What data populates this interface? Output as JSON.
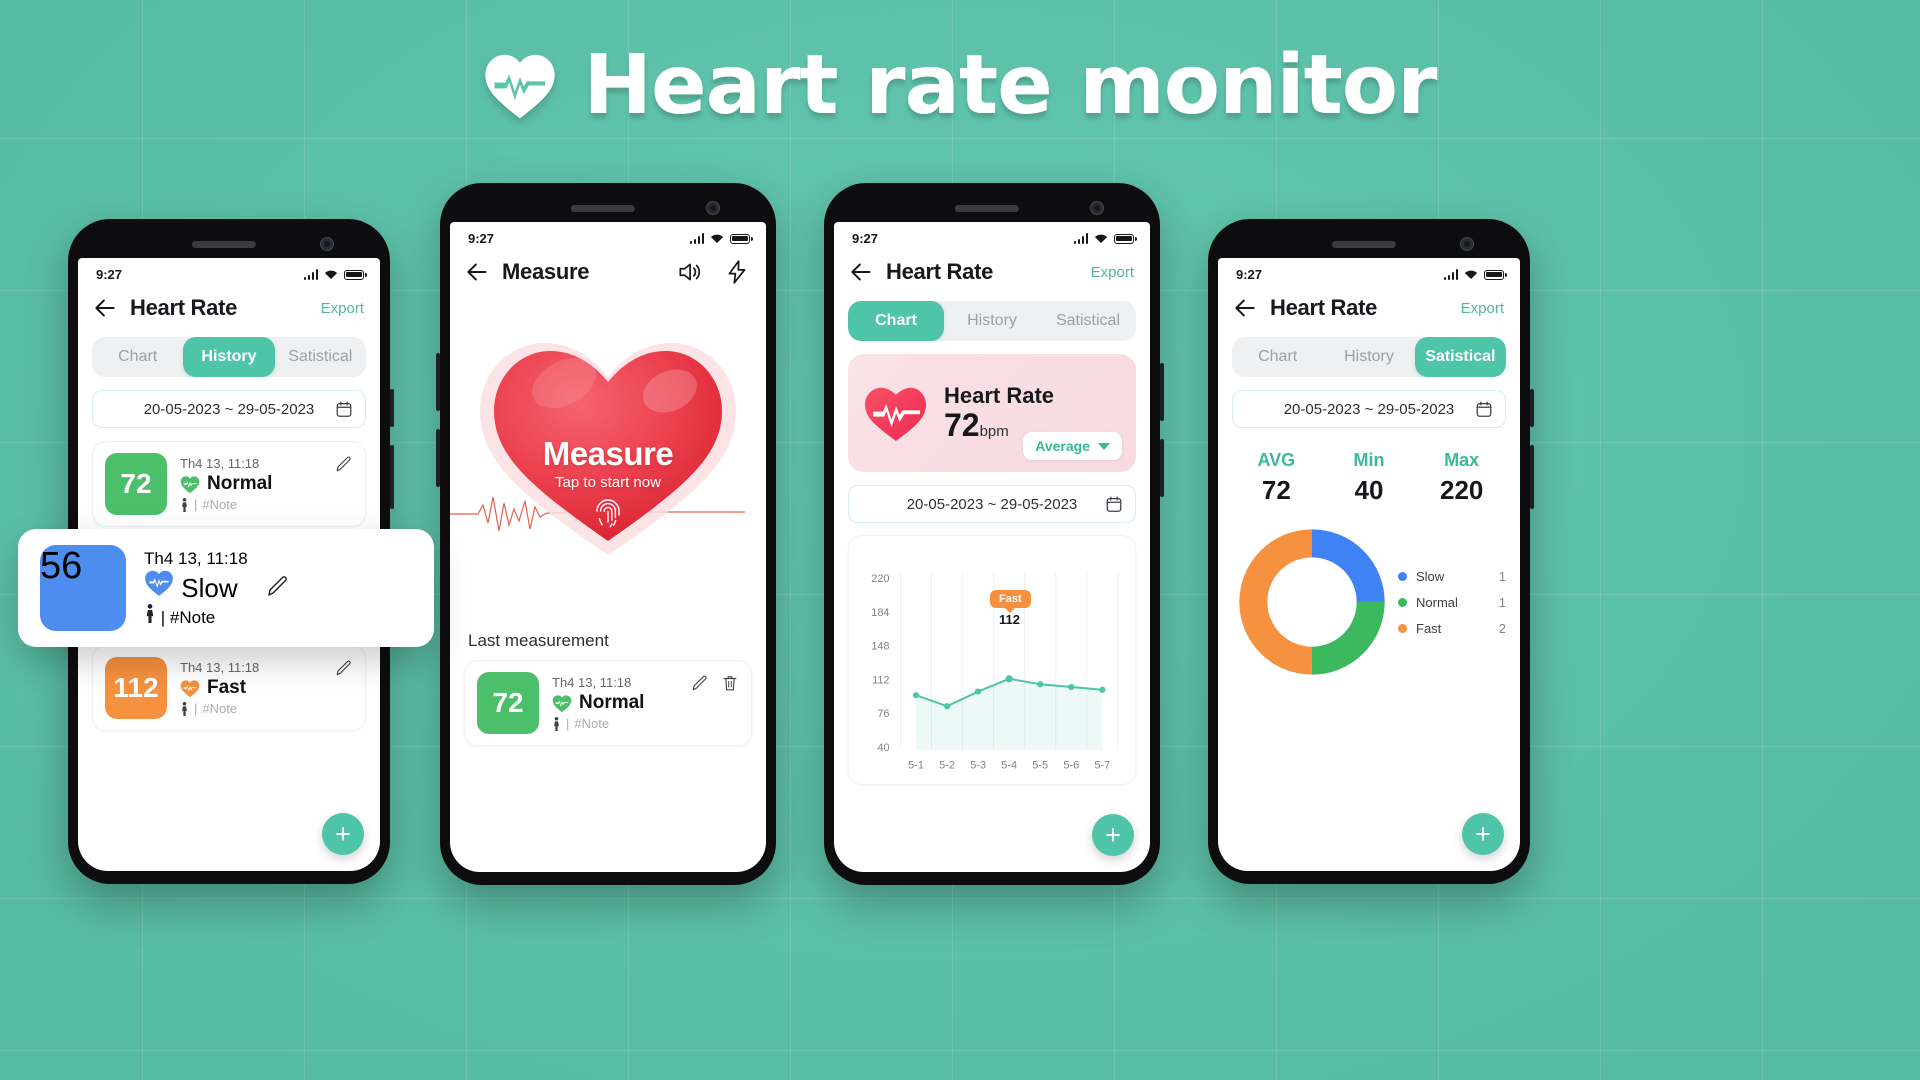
{
  "header": {
    "title": "Heart rate monitor",
    "logo_icon": "heart-pulse-icon"
  },
  "colors": {
    "background": "#5bc4ab",
    "accent": "#4ec4a8",
    "slow": "#4d8df0",
    "normal": "#4cbf6a",
    "fast": "#f5913f",
    "pink_card": "#fbe2e6",
    "heart_red": "#ef3b4a"
  },
  "phone1": {
    "status": {
      "time": "9:27"
    },
    "appbar": {
      "title": "Heart Rate",
      "export": "Export",
      "back_icon": "back-arrow-icon"
    },
    "tabs": [
      {
        "label": "Chart",
        "active": false
      },
      {
        "label": "History",
        "active": true
      },
      {
        "label": "Satistical",
        "active": false
      }
    ],
    "date_range": {
      "value": "20-05-2023 ~ 29-05-2023",
      "icon": "calendar-icon"
    },
    "records": [
      {
        "value": "72",
        "time": "Th4 13, 11:18",
        "state": "Normal",
        "note": "#Note",
        "color": "#4cbf6a"
      },
      {
        "value": "112",
        "time": "Th4 13, 11:18",
        "state": "Fast",
        "note": "#Note",
        "color": "#f5913f"
      }
    ],
    "highlight_record": {
      "value": "56",
      "time": "Th4 13, 11:18",
      "state": "Slow",
      "note": "#Note",
      "color": "#4d8df0"
    },
    "fab": "+"
  },
  "phone2": {
    "status": {
      "time": "9:27"
    },
    "appbar": {
      "title": "Measure",
      "back_icon": "back-arrow-icon",
      "sound_icon": "speaker-icon",
      "flash_icon": "flash-icon"
    },
    "measure": {
      "title": "Measure",
      "subtitle": "Tap to start now",
      "fingerprint_icon": "fingerprint-icon"
    },
    "last_label": "Last measurement",
    "last_record": {
      "value": "72",
      "time": "Th4 13, 11:18",
      "state": "Normal",
      "note": "#Note",
      "color": "#4cbf6a",
      "edit_icon": "pencil-icon",
      "delete_icon": "trash-icon"
    }
  },
  "phone3": {
    "status": {
      "time": "9:27"
    },
    "appbar": {
      "title": "Heart Rate",
      "export": "Export",
      "back_icon": "back-arrow-icon"
    },
    "tabs": [
      {
        "label": "Chart",
        "active": true
      },
      {
        "label": "History",
        "active": false
      },
      {
        "label": "Satistical",
        "active": false
      }
    ],
    "hr_card": {
      "title": "Heart Rate",
      "value": "72",
      "unit": "bpm",
      "dropdown": "Average",
      "icon": "heart-pulse-icon"
    },
    "date_range": {
      "value": "20-05-2023 ~ 29-05-2023",
      "icon": "calendar-icon"
    },
    "tooltip": {
      "label": "Fast",
      "value": "112"
    },
    "fab": "+"
  },
  "phone4": {
    "status": {
      "time": "9:27"
    },
    "appbar": {
      "title": "Heart Rate",
      "export": "Export",
      "back_icon": "back-arrow-icon"
    },
    "tabs": [
      {
        "label": "Chart",
        "active": false
      },
      {
        "label": "History",
        "active": false
      },
      {
        "label": "Satistical",
        "active": true
      }
    ],
    "date_range": {
      "value": "20-05-2023 ~ 29-05-2023",
      "icon": "calendar-icon"
    },
    "stats": [
      {
        "key": "AVG",
        "value": "72"
      },
      {
        "key": "Min",
        "value": "40"
      },
      {
        "key": "Max",
        "value": "220"
      }
    ],
    "legend": [
      {
        "name": "Slow",
        "count": "1",
        "color": "#4d8df0"
      },
      {
        "name": "Normal",
        "count": "1",
        "color": "#3cb95f"
      },
      {
        "name": "Fast",
        "count": "2",
        "color": "#f5913f"
      }
    ],
    "fab": "+"
  },
  "chart_data": [
    {
      "type": "line",
      "title": "Heart Rate",
      "x": [
        "5-1",
        "5-2",
        "5-3",
        "5-4",
        "5-5",
        "5-6",
        "5-7"
      ],
      "values": [
        95,
        83,
        99,
        112,
        107,
        104,
        101
      ],
      "ytick_labels": [
        "220",
        "184",
        "148",
        "112",
        "76",
        "40"
      ],
      "yticks": [
        220,
        184,
        148,
        112,
        76,
        40
      ],
      "ylim": [
        40,
        220
      ],
      "xlabel": "",
      "ylabel": "",
      "grid": true,
      "legend": "none",
      "annotation": {
        "label": "Fast",
        "value": 112,
        "x": "5-4"
      },
      "line_color": "#4ec4a8",
      "fill": true
    },
    {
      "type": "pie",
      "title": "Satistical",
      "categories": [
        "Slow",
        "Normal",
        "Fast"
      ],
      "values": [
        1,
        1,
        2
      ],
      "colors": [
        "#4d8df0",
        "#3cb95f",
        "#f5913f"
      ],
      "donut": true,
      "legend": "right"
    }
  ]
}
